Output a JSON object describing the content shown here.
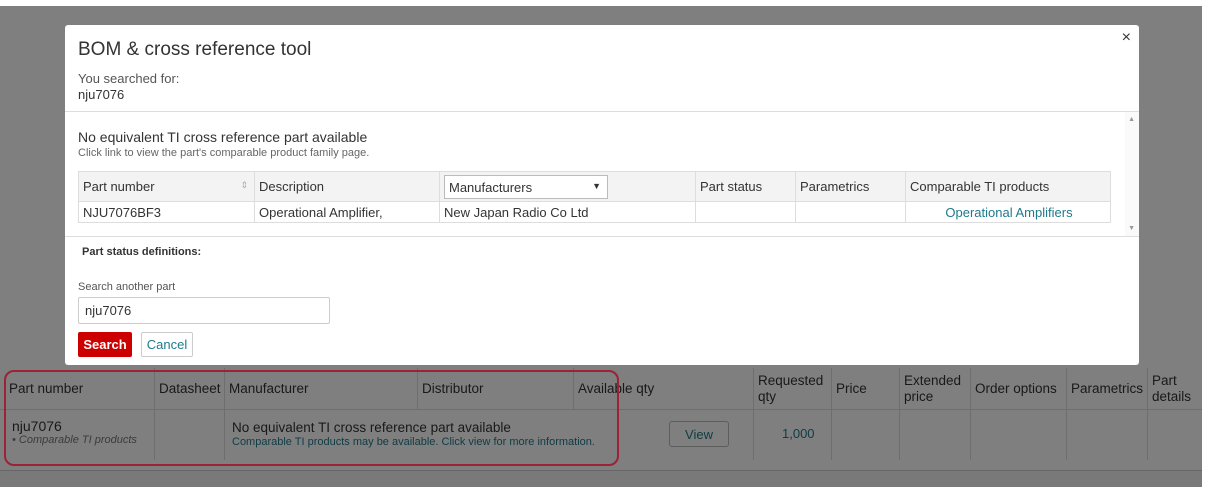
{
  "modal": {
    "title": "BOM & cross reference tool",
    "close_icon": "×",
    "searched_label": "You searched for:",
    "searched_value": "nju7076",
    "result_title": "No equivalent TI cross reference part available",
    "result_desc": "Click link to view the part's comparable product family page.",
    "table": {
      "headers": {
        "part_number": "Part number",
        "description": "Description",
        "manufacturers": "Manufacturers",
        "part_status": "Part status",
        "parametrics": "Parametrics",
        "comparable": "Comparable TI products"
      },
      "row": {
        "part_number": "NJU7076BF3",
        "description": "Operational Amplifier,",
        "manufacturer": "New Japan Radio Co Ltd",
        "part_status": "",
        "parametrics": "",
        "comparable": "Operational Amplifiers"
      }
    },
    "part_status_definitions": "Part status definitions:",
    "search_another_label": "Search another part",
    "search_value": "nju7076",
    "search_button": "Search",
    "cancel_button": "Cancel"
  },
  "background_table": {
    "headers": {
      "part_number": "Part number",
      "datasheet": "Datasheet",
      "manufacturer": "Manufacturer",
      "distributor": "Distributor",
      "available_qty": "Available qty",
      "requested_qty_1": "Requested",
      "requested_qty_2": "qty",
      "price": "Price",
      "extended_price_1": "Extended",
      "extended_price_2": "price",
      "order_options": "Order options",
      "parametrics": "Parametrics",
      "part_details_1": "Part",
      "part_details_2": "details"
    },
    "row": {
      "part": "nju7076",
      "part_sub": "• Comparable TI products",
      "message": "No equivalent TI cross reference part available",
      "message_sub": "Comparable TI products may be available. Click view for more information.",
      "view_button": "View",
      "requested_qty": "1,000"
    }
  },
  "colors": {
    "accent": "#cc0000",
    "link": "#1f7a8c",
    "highlight": "#9b2335"
  }
}
